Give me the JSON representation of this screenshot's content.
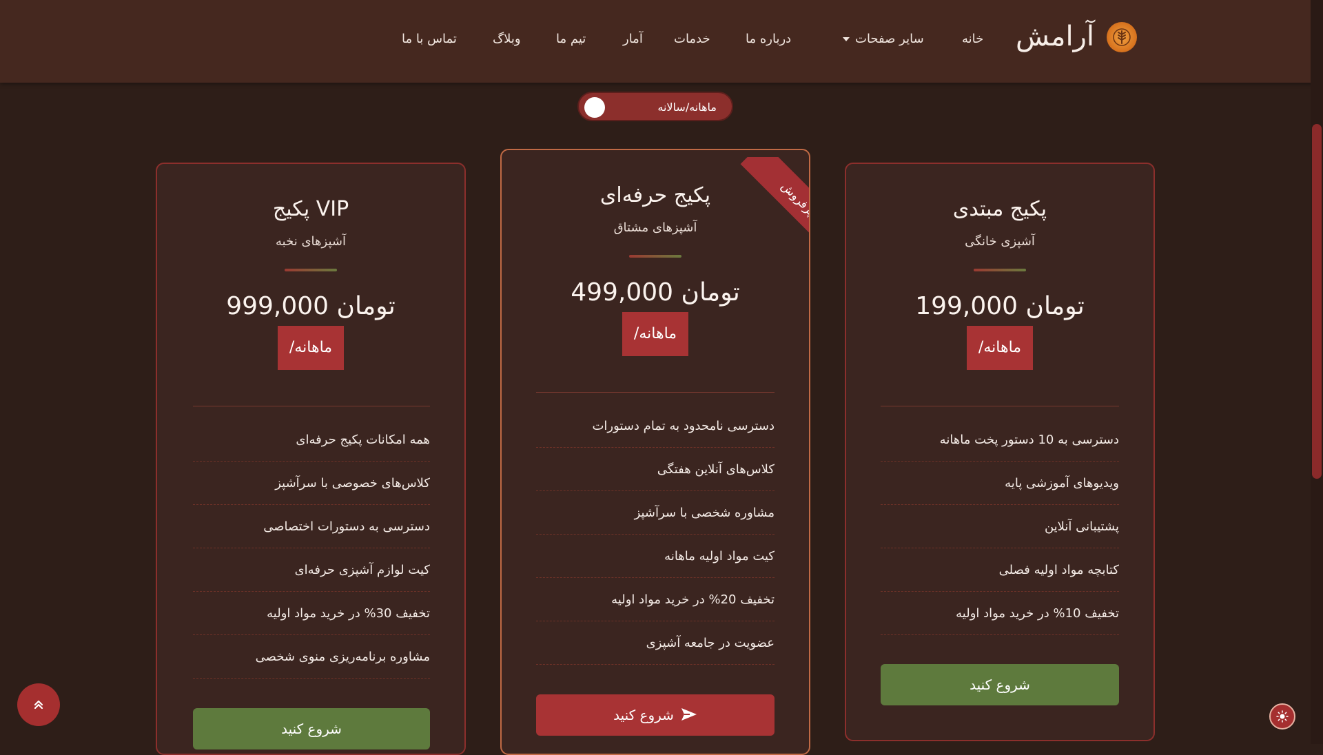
{
  "brand": {
    "name": "آرامش",
    "logo_icon": "wheat-logo-icon"
  },
  "nav": {
    "home": "خانه",
    "other_pages": "سایر صفحات",
    "about": "درباره ما",
    "services": "خدمات",
    "stats": "آمار",
    "team": "تیم ما",
    "blog": "وبلاگ",
    "contact": "تماس با ما"
  },
  "billing_toggle": {
    "label": "ماهانه/سالانه",
    "state": "monthly"
  },
  "plans": {
    "basic": {
      "title": "پکیج مبتدی",
      "subtitle": "آشپزی خانگی",
      "price": "199,000 تومان",
      "period": "/ماهانه",
      "features": [
        "دسترسی به 10 دستور پخت ماهانه",
        "ویدیوهای آموزشی پایه",
        "پشتیبانی آنلاین",
        "کتابچه مواد اولیه فصلی",
        "تخفیف 10% در خرید مواد اولیه"
      ],
      "cta": "شروع کنید"
    },
    "pro": {
      "title": "پکیج حرفه‌ای",
      "subtitle": "آشپزهای مشتاق",
      "price": "499,000 تومان",
      "period": "/ماهانه",
      "ribbon": "پرفروش",
      "features": [
        "دسترسی نامحدود به تمام دستورات",
        "کلاس‌های آنلاین هفتگی",
        "مشاوره شخصی با سرآشپز",
        "کیت مواد اولیه ماهانه",
        "تخفیف 20% در خرید مواد اولیه",
        "عضویت در جامعه آشپزی"
      ],
      "cta": "شروع کنید"
    },
    "vip": {
      "title": "پکیج VIP",
      "subtitle": "آشپزهای نخبه",
      "price": "999,000 تومان",
      "period": "/ماهانه",
      "features": [
        "همه امکانات پکیج حرفه‌ای",
        "کلاس‌های خصوصی با سرآشپز",
        "دسترسی به دستورات اختصاصی",
        "کیت لوازم آشپزی حرفه‌ای",
        "تخفیف 30% در خرید مواد اولیه",
        "مشاوره برنامه‌ریزی منوی شخصی"
      ],
      "cta": "شروع کنید"
    }
  },
  "colors": {
    "background": "#2e1e18",
    "navbar": "#45281f",
    "accent_red": "#a83334",
    "accent_green": "#5e7a3d"
  },
  "icons": {
    "back_to_top": "chevron-double-up-icon",
    "theme": "sun-icon",
    "cta_send": "send-icon"
  }
}
